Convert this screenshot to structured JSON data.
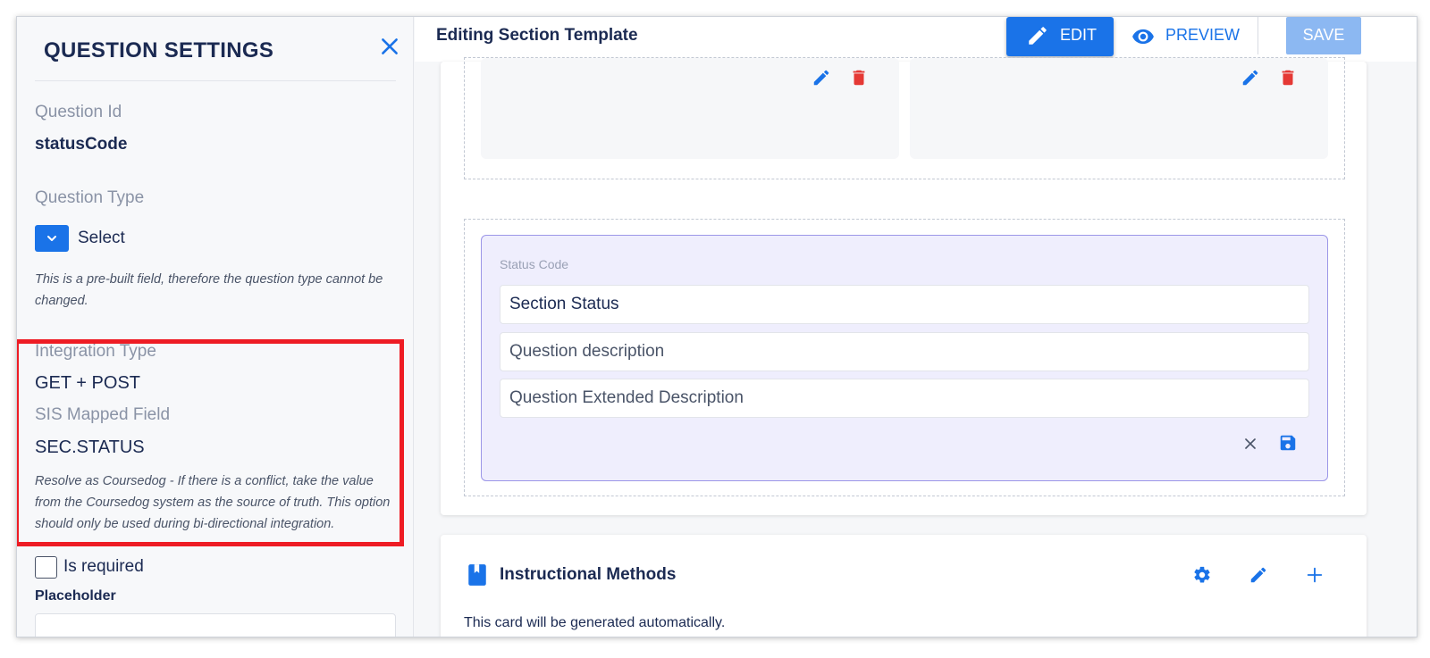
{
  "sidebar": {
    "title": "QUESTION SETTINGS",
    "question_id_label": "Question Id",
    "question_id_value": "statusCode",
    "question_type_label": "Question Type",
    "question_type_value": "Select",
    "question_type_note": "This is a pre-built field, therefore the question type cannot be changed.",
    "integration_type_label": "Integration Type",
    "integration_type_value": "GET + POST",
    "sis_field_label": "SIS Mapped Field",
    "sis_field_value": "SEC.STATUS",
    "resolve_note": "Resolve as Coursedog - If there is a conflict, take the value from the Coursedog system as the source of truth. This option should only be used during bi-directional integration.",
    "is_required_label": "Is required",
    "is_required_checked": false,
    "placeholder_label": "Placeholder",
    "placeholder_value": ""
  },
  "topbar": {
    "title": "Editing Section Template",
    "edit_label": "EDIT",
    "preview_label": "PREVIEW",
    "save_label": "SAVE"
  },
  "question_card": {
    "field_label": "Status Code",
    "name_value": "Section Status",
    "description_placeholder": "Question description",
    "extended_description_placeholder": "Question Extended Description"
  },
  "bottom_card": {
    "title": "Instructional Methods",
    "text": "This card will be generated automatically."
  },
  "colors": {
    "accent": "#1a73e8",
    "delete": "#e53935",
    "highlight": "#ee1c24",
    "question_card_bg": "#efeefd"
  }
}
